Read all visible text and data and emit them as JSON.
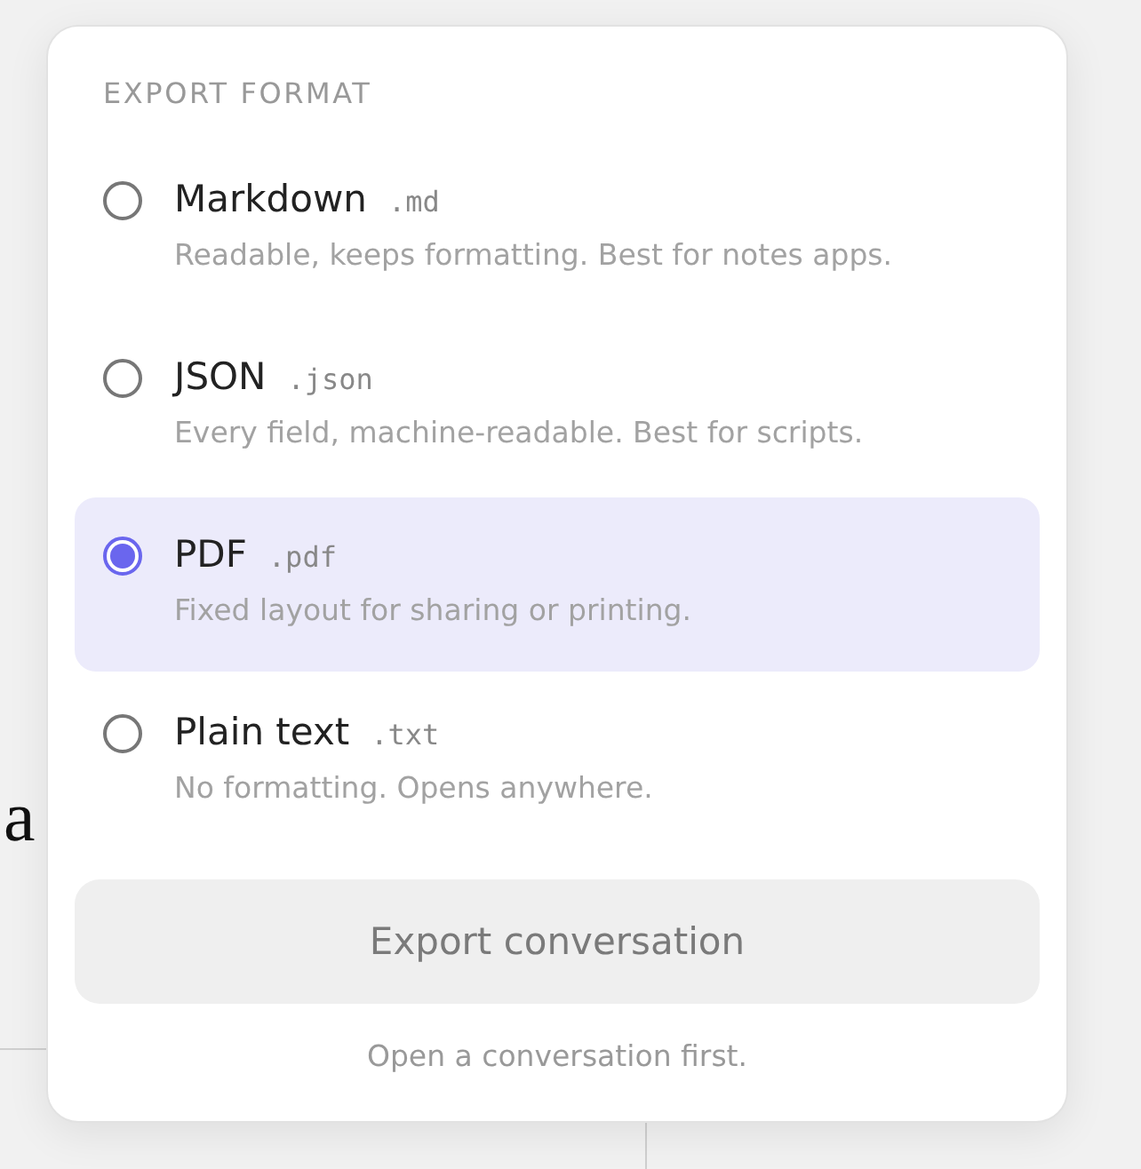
{
  "background_text": "a",
  "heading": "EXPORT FORMAT",
  "options": [
    {
      "label": "Markdown",
      "extension": ".md",
      "description": "Readable, keeps formatting. Best for notes apps.",
      "selected": false
    },
    {
      "label": "JSON",
      "extension": ".json",
      "description": "Every field, machine-readable. Best for scripts.",
      "selected": false
    },
    {
      "label": "PDF",
      "extension": ".pdf",
      "description": "Fixed layout for sharing or printing.",
      "selected": true
    },
    {
      "label": "Plain text",
      "extension": ".txt",
      "description": "No formatting. Opens anywhere.",
      "selected": false
    }
  ],
  "export_button": {
    "label": "Export conversation",
    "disabled": true
  },
  "hint": "Open a conversation first."
}
